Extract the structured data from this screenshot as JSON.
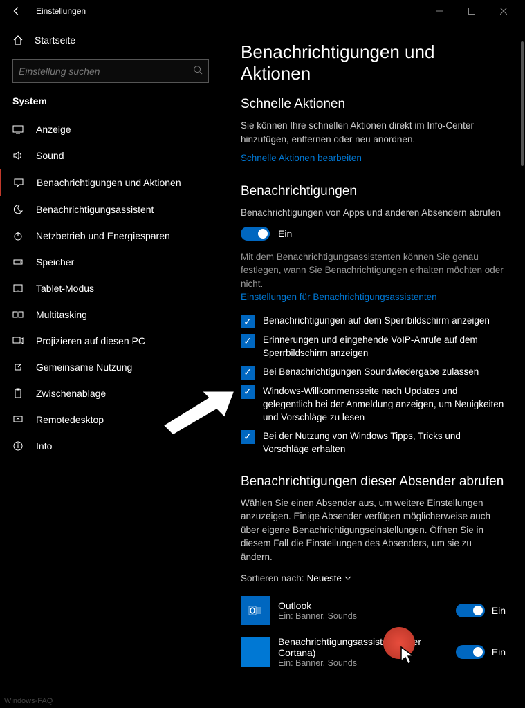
{
  "titlebar": {
    "title": "Einstellungen"
  },
  "sidebar": {
    "home": "Startseite",
    "search_placeholder": "Einstellung suchen",
    "category": "System",
    "items": [
      {
        "label": "Anzeige",
        "icon": "display"
      },
      {
        "label": "Sound",
        "icon": "sound"
      },
      {
        "label": "Benachrichtigungen und Aktionen",
        "icon": "chat",
        "selected": true
      },
      {
        "label": "Benachrichtigungsassistent",
        "icon": "moon"
      },
      {
        "label": "Netzbetrieb und Energiesparen",
        "icon": "power"
      },
      {
        "label": "Speicher",
        "icon": "storage"
      },
      {
        "label": "Tablet-Modus",
        "icon": "tablet"
      },
      {
        "label": "Multitasking",
        "icon": "multitask"
      },
      {
        "label": "Projizieren auf diesen PC",
        "icon": "project"
      },
      {
        "label": "Gemeinsame Nutzung",
        "icon": "share"
      },
      {
        "label": "Zwischenablage",
        "icon": "clipboard"
      },
      {
        "label": "Remotedesktop",
        "icon": "remote"
      },
      {
        "label": "Info",
        "icon": "info"
      }
    ]
  },
  "main": {
    "heading": "Benachrichtigungen und Aktionen",
    "quick_actions": {
      "title": "Schnelle Aktionen",
      "desc": "Sie können Ihre schnellen Aktionen direkt im Info-Center hinzufügen, entfernen oder neu anordnen.",
      "link": "Schnelle Aktionen bearbeiten"
    },
    "notifications": {
      "title": "Benachrichtigungen",
      "master_label": "Benachrichtigungen von Apps und anderen Absendern abrufen",
      "master_state": "Ein",
      "assist_desc": "Mit dem Benachrichtigungsassistenten können Sie genau festlegen, wann Sie Benachrichtigungen erhalten möchten oder nicht.",
      "assist_link": "Einstellungen für Benachrichtigungsassistenten",
      "checks": [
        "Benachrichtigungen auf dem Sperrbildschirm anzeigen",
        "Erinnerungen und eingehende VoIP-Anrufe auf dem Sperrbildschirm anzeigen",
        "Bei Benachrichtigungen Soundwiedergabe zulassen",
        "Windows-Willkommensseite nach Updates und gelegentlich bei der Anmeldung anzeigen, um Neuigkeiten und Vorschläge zu lesen",
        "Bei der Nutzung von Windows Tipps, Tricks und Vorschläge erhalten"
      ]
    },
    "senders": {
      "title": "Benachrichtigungen dieser Absender abrufen",
      "desc": "Wählen Sie einen Absender aus, um weitere Einstellungen anzuzeigen. Einige Absender verfügen möglicherweise auch über eigene Benachrichtigungseinstellungen. Öffnen Sie in diesem Fall die Einstellungen des Absenders, um sie zu ändern.",
      "sort_label": "Sortieren nach:",
      "sort_value": "Neueste",
      "list": [
        {
          "name": "Outlook",
          "sub": "Ein: Banner, Sounds",
          "state": "Ein"
        },
        {
          "name": "Benachrichtigungsassistent (über Cortana)",
          "sub": "Ein: Banner, Sounds",
          "state": "Ein"
        }
      ]
    }
  },
  "watermark": "Windows-FAQ"
}
